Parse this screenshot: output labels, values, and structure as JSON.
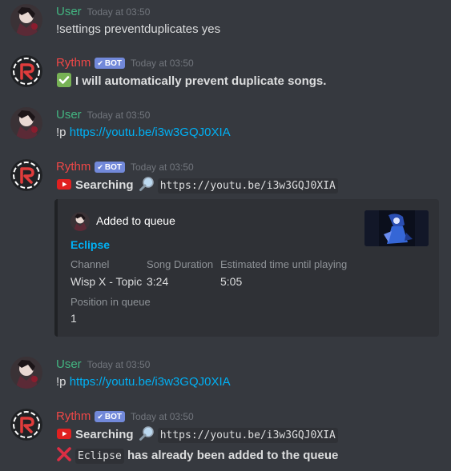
{
  "users": {
    "user": {
      "name": "User",
      "color": "#43b581"
    },
    "rythm": {
      "name": "Rythm",
      "color": "#f04747",
      "bot_tag": "BOT"
    }
  },
  "messages": [
    {
      "author": "User",
      "timestamp": "Today at 03:50",
      "lines": [
        "!settings preventduplicates yes"
      ]
    },
    {
      "author": "Rythm",
      "timestamp": "Today at 03:50",
      "lines": [
        "I will automatically prevent duplicate songs."
      ],
      "icon": "white-check-mark-icon"
    },
    {
      "author": "User",
      "timestamp": "Today at 03:50",
      "prefix": "!p ",
      "link": "https://youtu.be/i3w3GQJ0XIA"
    },
    {
      "author": "Rythm",
      "timestamp": "Today at 03:50",
      "searching_label": "Searching",
      "code": "https://youtu.be/i3w3GQJ0XIA",
      "embed": {
        "author": "Added to queue",
        "title": "Eclipse",
        "fields": [
          {
            "name": "Channel",
            "value": "Wisp X - Topic"
          },
          {
            "name": "Song Duration",
            "value": "3:24"
          },
          {
            "name": "Estimated time until playing",
            "value": "5:05"
          },
          {
            "name": "Position in queue",
            "value": "1"
          }
        ]
      }
    },
    {
      "author": "User",
      "timestamp": "Today at 03:50",
      "prefix": "!p ",
      "link": "https://youtu.be/i3w3GQJ0XIA"
    },
    {
      "author": "Rythm",
      "timestamp": "Today at 03:50",
      "searching_label": "Searching",
      "code": "https://youtu.be/i3w3GQJ0XIA",
      "error_code": "Eclipse",
      "error_text": "has already been added to the queue"
    }
  ],
  "colors": {
    "background": "#36393f",
    "link": "#00b0f4",
    "embed_bg": "#2f3136",
    "bot_tag": "#7289da"
  }
}
